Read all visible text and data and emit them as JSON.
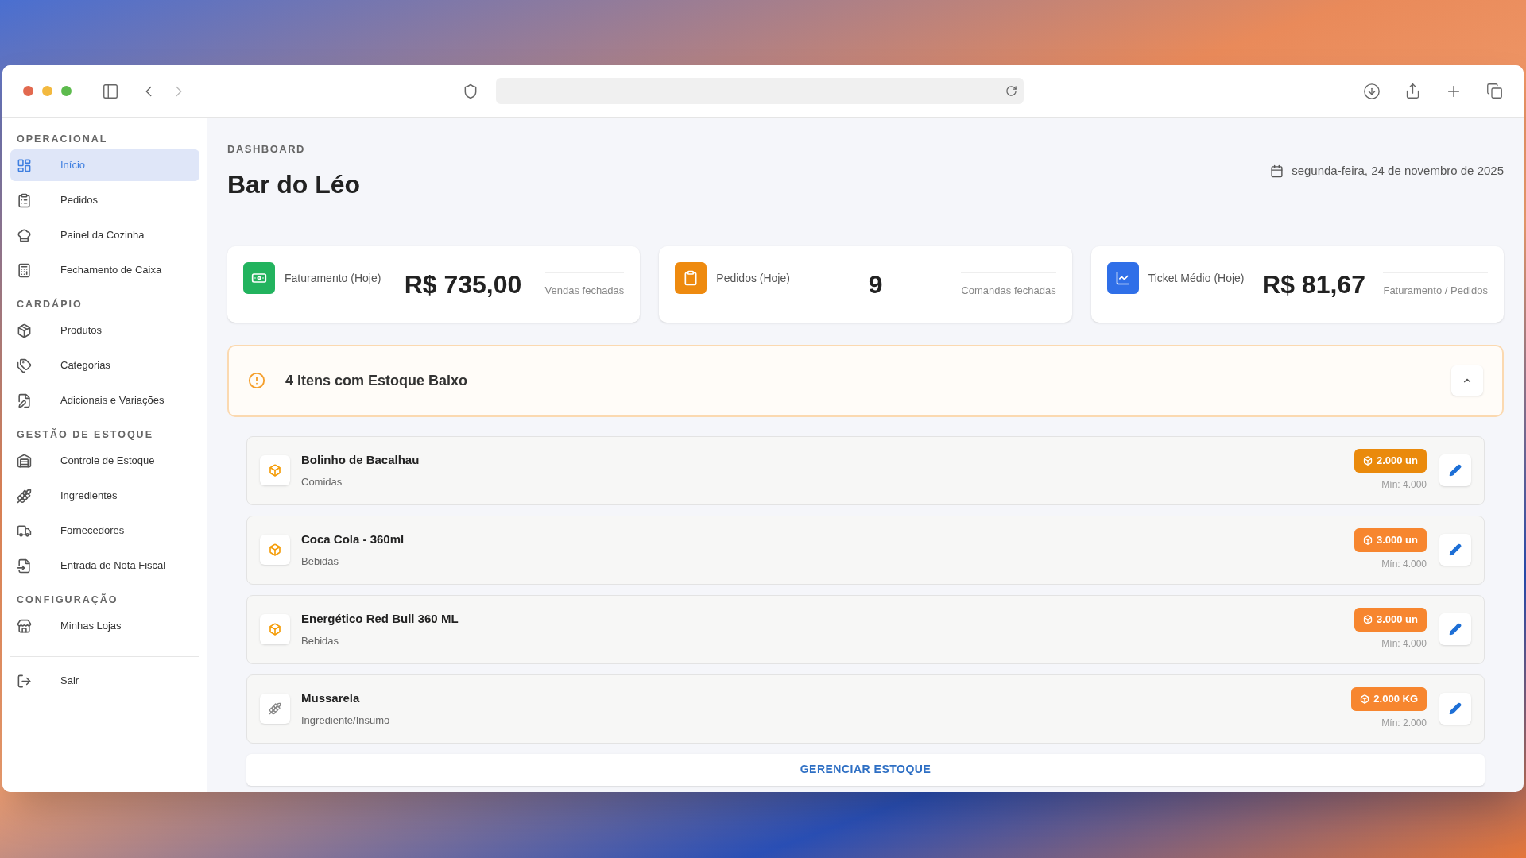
{
  "sidebar": {
    "sections": [
      {
        "title": "OPERACIONAL",
        "items": [
          {
            "label": "Início",
            "selected": true
          },
          {
            "label": "Pedidos",
            "selected": false
          },
          {
            "label": "Painel da Cozinha",
            "selected": false
          },
          {
            "label": "Fechamento de Caixa",
            "selected": false
          }
        ]
      },
      {
        "title": "CARDÁPIO",
        "items": [
          {
            "label": "Produtos",
            "selected": false
          },
          {
            "label": "Categorias",
            "selected": false
          },
          {
            "label": "Adicionais e Variações",
            "selected": false
          }
        ]
      },
      {
        "title": "GESTÃO DE ESTOQUE",
        "items": [
          {
            "label": "Controle de Estoque",
            "selected": false
          },
          {
            "label": "Ingredientes",
            "selected": false
          },
          {
            "label": "Fornecedores",
            "selected": false
          },
          {
            "label": "Entrada de Nota Fiscal",
            "selected": false
          }
        ]
      },
      {
        "title": "CONFIGURAÇÃO",
        "items": [
          {
            "label": "Minhas Lojas",
            "selected": false
          }
        ]
      }
    ],
    "logout": "Sair"
  },
  "header": {
    "eyebrow": "DASHBOARD",
    "title": "Bar do Léo",
    "date": "segunda-feira, 24 de novembro de 2025"
  },
  "stats": [
    {
      "label": "Faturamento (Hoje)",
      "value": "R$ 735,00",
      "note": "Vendas fechadas",
      "color": "#22b35e"
    },
    {
      "label": "Pedidos (Hoje)",
      "value": "9",
      "note": "Comandas fechadas",
      "color": "#ee8a0f"
    },
    {
      "label": "Ticket Médio (Hoje)",
      "value": "R$ 81,67",
      "note": "Faturamento / Pedidos",
      "color": "#2f6fe8"
    }
  ],
  "alert": {
    "title": "4 Itens com Estoque Baixo",
    "expanded": true
  },
  "low_stock": [
    {
      "name": "Bolinho de Bacalhau",
      "category": "Comidas",
      "kind": "product",
      "stock": "2.000 un",
      "min": "Mín: 4.000",
      "color": "#ea8a0c"
    },
    {
      "name": "Coca Cola - 360ml",
      "category": "Bebidas",
      "kind": "product",
      "stock": "3.000 un",
      "min": "Mín: 4.000",
      "color": "#f7862f"
    },
    {
      "name": "Energético Red Bull 360 ML",
      "category": "Bebidas",
      "kind": "product",
      "stock": "3.000 un",
      "min": "Mín: 4.000",
      "color": "#f7862f"
    },
    {
      "name": "Mussarela",
      "category": "Ingrediente/Insumo",
      "kind": "ingredient",
      "stock": "2.000 KG",
      "min": "Mín: 2.000",
      "color": "#f7862f"
    }
  ],
  "manage_button": "GERENCIAR ESTOQUE"
}
